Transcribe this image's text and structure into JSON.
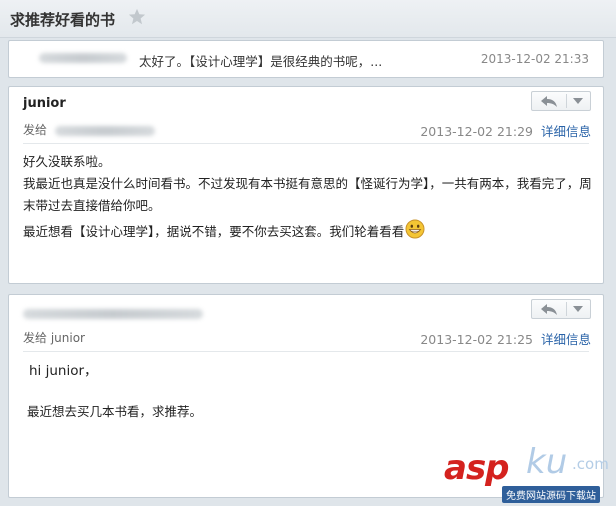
{
  "subject": "求推荐好看的书",
  "collapsed": {
    "preview": "太好了。【设计心理学】是很经典的书呢，...",
    "date": "2013-12-02 21:33"
  },
  "message1": {
    "sender": "junior",
    "to_prefix": "发给",
    "date": "2013-12-02 21:29",
    "details_label": "详细信息",
    "lines": [
      "好久没联系啦。",
      "我最近也真是没什么时间看书。不过发现有本书挺有意思的【怪诞行为学】，一共有两本，我看完了，周末带过去直接借给你吧。",
      "最近想看【设计心理学】，据说不错，要不你去买这套。我们轮着看看"
    ]
  },
  "message2": {
    "to_label": "发给 junior",
    "date": "2013-12-02 21:25",
    "details_label": "详细信息",
    "greeting": "hi junior，",
    "line": "最近想去买几本书看，求推荐。"
  },
  "watermark": {
    "asp": "asp",
    "ku": "ku",
    "com": ".com",
    "caption": "免费网站源码下载站"
  },
  "colors": {
    "link": "#2a63a8",
    "watermark_red": "#d4221e"
  }
}
